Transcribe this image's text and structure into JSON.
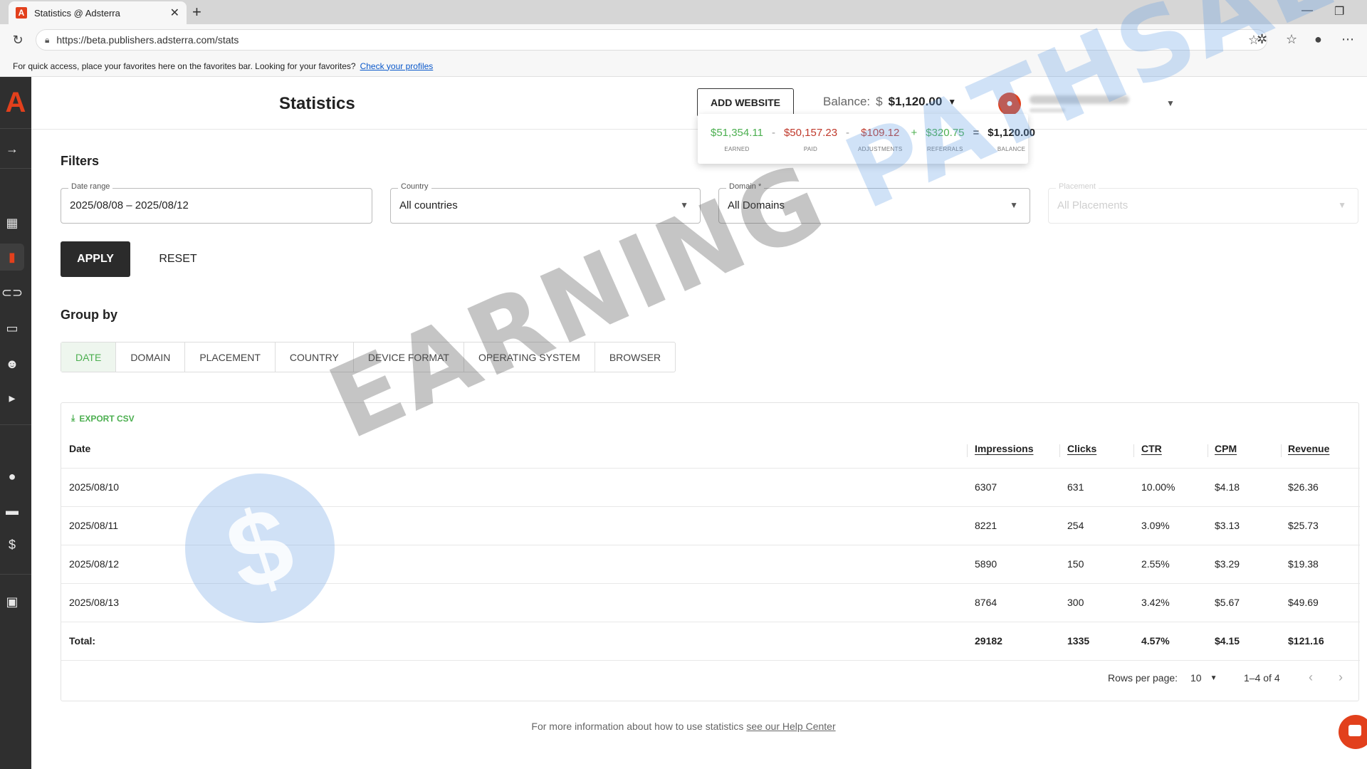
{
  "browser": {
    "tab_title": "Statistics @ Adsterra",
    "url": "https://beta.publishers.adsterra.com/stats",
    "favorites_message": "For quick access, place your favorites here on the favorites bar. Looking for your favorites?",
    "favorites_link": "Check your profiles"
  },
  "header": {
    "title": "Statistics",
    "add_website": "ADD WEBSITE",
    "balance_label": "Balance:",
    "balance_currency": "$",
    "balance_amount": "$1,120.00"
  },
  "balance_popup": {
    "earned": "$51,354.11",
    "earned_label": "EARNED",
    "paid": "$50,157.23",
    "paid_label": "PAID",
    "adjustments": "$109.12",
    "adjustments_label": "ADJUSTMENTS",
    "referrals": "$320.75",
    "referrals_label": "REFERRALS",
    "balance": "$1,120.00",
    "balance_label": "BALANCE",
    "op_minus": "-",
    "op_plus": "+",
    "op_equals": "="
  },
  "filters": {
    "title": "Filters",
    "date_range_label": "Date range",
    "date_range_value": "2025/08/08 – 2025/08/12",
    "country_label": "Country",
    "country_value": "All countries",
    "domain_label": "Domain *",
    "domain_value": "All Domains",
    "placement_label": "Placement",
    "placement_value": "All Placements",
    "apply": "APPLY",
    "reset": "RESET"
  },
  "group_by": {
    "title": "Group by",
    "tabs": [
      "DATE",
      "DOMAIN",
      "PLACEMENT",
      "COUNTRY",
      "DEVICE FORMAT",
      "OPERATING SYSTEM",
      "BROWSER"
    ]
  },
  "table": {
    "export": "EXPORT CSV",
    "headers": {
      "date": "Date",
      "impressions": "Impressions",
      "clicks": "Clicks",
      "ctr": "CTR",
      "cpm": "CPM",
      "revenue": "Revenue"
    },
    "rows": [
      {
        "date": "2025/08/10",
        "impressions": "6307",
        "clicks": "631",
        "ctr": "10.00%",
        "cpm": "$4.18",
        "revenue": "$26.36"
      },
      {
        "date": "2025/08/11",
        "impressions": "8221",
        "clicks": "254",
        "ctr": "3.09%",
        "cpm": "$3.13",
        "revenue": "$25.73"
      },
      {
        "date": "2025/08/12",
        "impressions": "5890",
        "clicks": "150",
        "ctr": "2.55%",
        "cpm": "$3.29",
        "revenue": "$19.38"
      },
      {
        "date": "2025/08/13",
        "impressions": "8764",
        "clicks": "300",
        "ctr": "3.42%",
        "cpm": "$5.67",
        "revenue": "$49.69"
      }
    ],
    "total": {
      "label": "Total:",
      "impressions": "29182",
      "clicks": "1335",
      "ctr": "4.57%",
      "cpm": "$4.15",
      "revenue": "$121.16"
    },
    "rows_per_page_label": "Rows per page:",
    "rows_per_page": "10",
    "range": "1–4 of 4"
  },
  "footer": {
    "help_text": "For more information about how to use statistics",
    "help_link": "see our Help Center"
  },
  "watermark": {
    "part1": "EARNING",
    "part2": "PATHSALA",
    "coin": "$"
  },
  "colors": {
    "brand": "#e2401c",
    "positive": "#4caf50",
    "negative": "#c0392b",
    "sidebar": "#2f2f2f"
  }
}
